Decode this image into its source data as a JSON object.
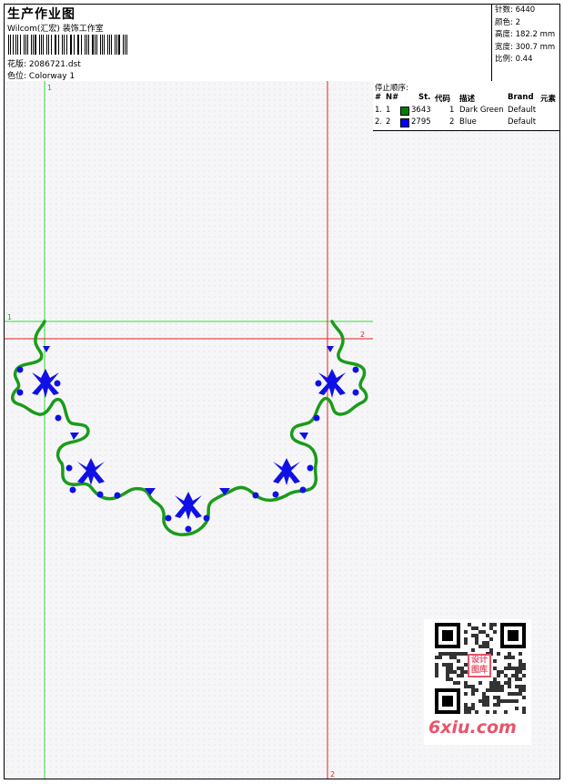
{
  "header": {
    "title": "生产作业图",
    "company": "Wilcom(汇宏) 装饰工作室",
    "design_label": "花版:",
    "design_value": "2086721.dst",
    "colorway_label": "色位:",
    "colorway_value": "Colorway 1"
  },
  "stats": {
    "stitches": "针数: 6440",
    "colors": "颜色: 2",
    "height": "高度: 182.2 mm",
    "width": "宽度: 300.7 mm",
    "scale": "比例: 0.44"
  },
  "stop_sequence": {
    "title": "停止顺序:",
    "columns": [
      "#",
      "N#",
      "St.",
      "代码",
      "描述",
      "Brand",
      "元素"
    ],
    "rows": [
      {
        "idx": "1.",
        "n": "1",
        "color": "#008000",
        "stitches": "3643",
        "code": "1",
        "desc": "Dark Green",
        "brand": "Default"
      },
      {
        "idx": "2.",
        "n": "2",
        "color": "#0000ff",
        "stitches": "2795",
        "code": "2",
        "desc": "Blue",
        "brand": "Default"
      }
    ]
  },
  "guides": {
    "v1": "1",
    "h1": "1",
    "h2": "2",
    "v2": "2"
  },
  "watermark": {
    "site": "6xiu.com",
    "seal": "设计图库"
  },
  "colors": {
    "green": "#1a9c1a",
    "blue": "#1010e6",
    "guide_green": "#33dd33",
    "guide_red": "#e02020"
  }
}
